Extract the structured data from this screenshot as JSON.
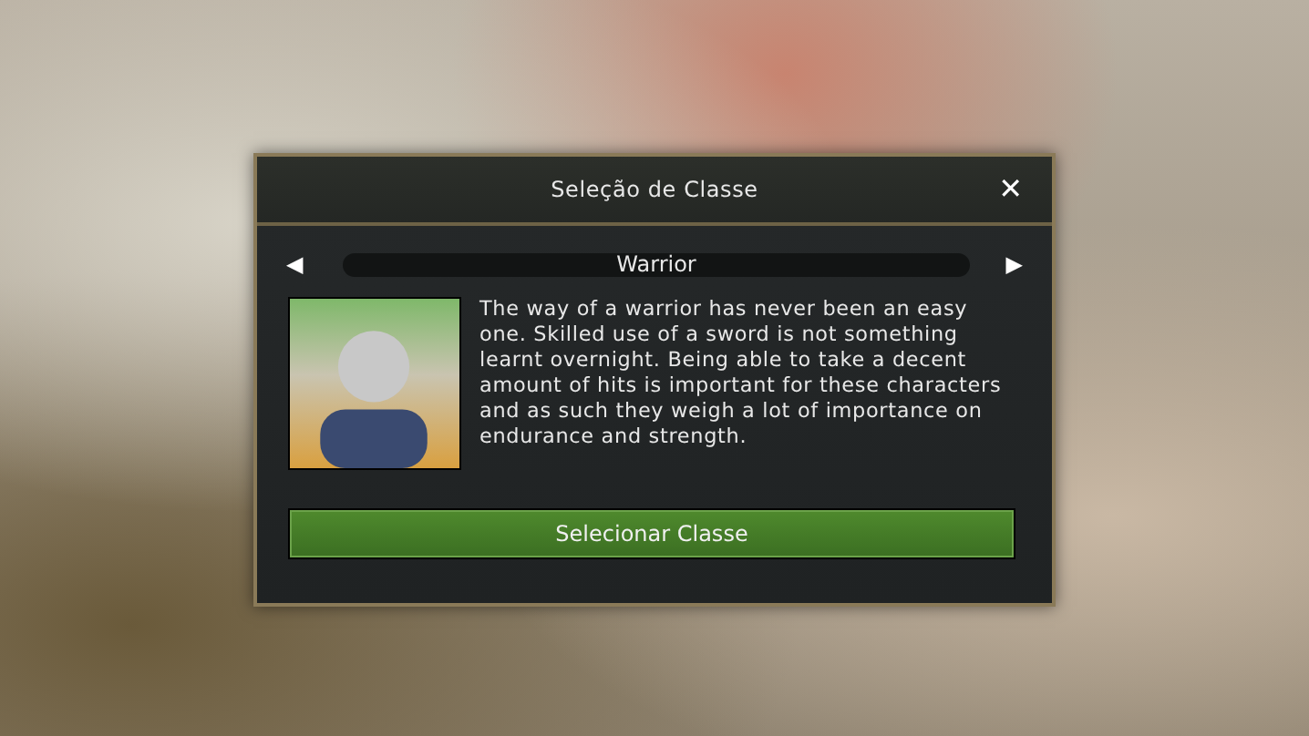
{
  "dialog": {
    "title": "Seleção de Classe",
    "close": "✕"
  },
  "selector": {
    "prev": "◀",
    "value": "Warrior",
    "next": "▶"
  },
  "description": "The way of a warrior has never been an easy one. Skilled use of a sword is not something learnt overnight. Being able to take a decent amount of hits is important for these characters and as such they weigh a lot of importance on endurance and strength.",
  "buttons": [
    "Selecionar Classe"
  ]
}
